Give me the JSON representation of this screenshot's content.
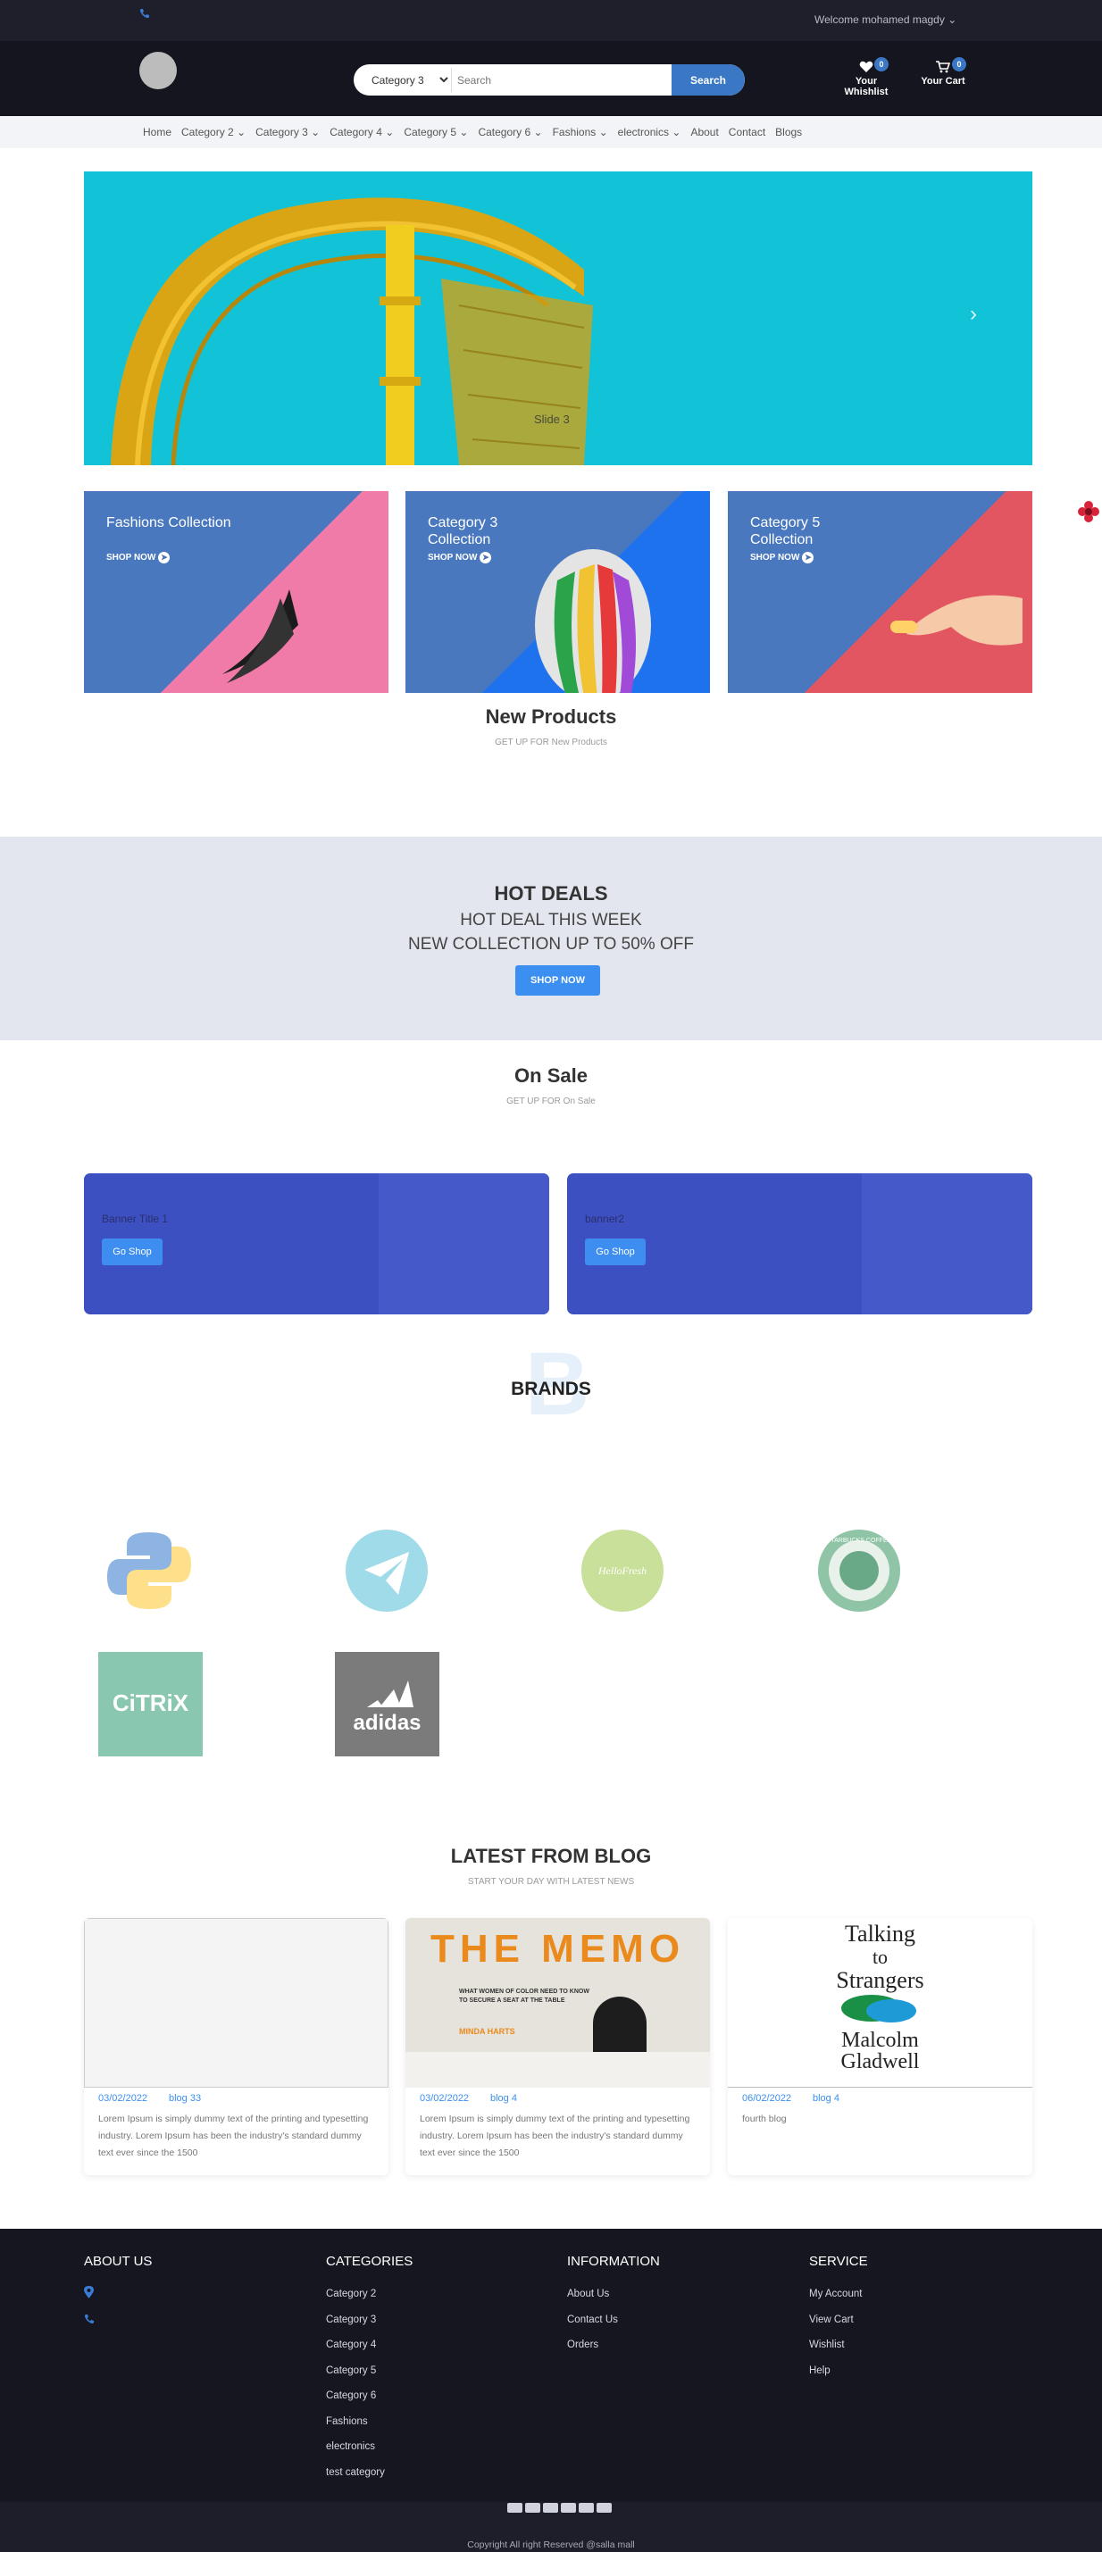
{
  "topbar": {
    "welcome": "Welcome mohamed magdy"
  },
  "header": {
    "search": {
      "category": "Category 3",
      "categories": [
        "Category 3"
      ],
      "placeholder": "Search",
      "button": "Search"
    },
    "wishlist": {
      "label": "Your Whishlist",
      "count": "0"
    },
    "cart": {
      "label": "Your Cart",
      "count": "0"
    }
  },
  "nav": {
    "items": [
      "Home",
      "Category 2",
      "Category 3",
      "Category 4",
      "Category 5",
      "Category 6",
      "Fashions",
      "electronics",
      "About",
      "Contact",
      "Blogs"
    ]
  },
  "slider": {
    "caption": "Slide 3"
  },
  "categories": [
    {
      "title": "Fashions Collection",
      "shop": "SHOP NOW"
    },
    {
      "title": "Category 3 Collection",
      "shop": "SHOP NOW"
    },
    {
      "title": "Category 5 Collection",
      "shop": "SHOP NOW"
    }
  ],
  "new_products": {
    "title": "New Products",
    "subtitle": "GET UP FOR New Products"
  },
  "hot_deals": {
    "title": "HOT DEALS",
    "line1": "HOT DEAL THIS WEEK",
    "line2": "NEW COLLECTION UP TO 50% OFF",
    "button": "SHOP NOW"
  },
  "on_sale": {
    "title": "On Sale",
    "subtitle": "GET UP FOR On Sale"
  },
  "banners": [
    {
      "title": "Banner Title 1",
      "button": "Go Shop"
    },
    {
      "title": "banner2",
      "button": "Go Shop"
    }
  ],
  "brands": {
    "title": "BRANDS",
    "bg_letter": "B",
    "citrix": "CiTRiX",
    "adidas": "adidas",
    "hellofresh": "HelloFresh",
    "starbucks": "STARBUCKS COFFEE"
  },
  "blog": {
    "title": "LATEST FROM BLOG",
    "subtitle": "START YOUR DAY WITH LATEST NEWS",
    "posts": [
      {
        "date": "03/02/2022",
        "name": "blog 33",
        "text": "Lorem Ipsum is simply dummy text of the printing and typesetting industry. Lorem Ipsum has been the industry's standard dummy text ever since the 1500"
      },
      {
        "date": "03/02/2022",
        "name": "blog 4",
        "text": "Lorem Ipsum is simply dummy text of the printing and typesetting industry. Lorem Ipsum has been the industry's standard dummy text ever since the 1500",
        "img_title": "THE MEMO",
        "img_sub": "WHAT WOMEN OF COLOR NEED TO KNOW TO SECURE A SEAT AT THE TABLE",
        "img_author": "MINDA HARTS"
      },
      {
        "date": "06/02/2022",
        "name": "blog 4",
        "text": "fourth blog",
        "img_title1": "Talking",
        "img_title2": "to",
        "img_title3": "Strangers",
        "img_author1": "Malcolm",
        "img_author2": "Gladwell"
      }
    ]
  },
  "footer": {
    "about": {
      "title": "ABOUT US"
    },
    "categories": {
      "title": "CATEGORIES",
      "items": [
        "Category 2",
        "Category 3",
        "Category 4",
        "Category 5",
        "Category 6",
        "Fashions",
        "electronics",
        "test category"
      ]
    },
    "information": {
      "title": "INFORMATION",
      "items": [
        "About Us",
        "Contact Us",
        "Orders"
      ]
    },
    "service": {
      "title": "SERVICE",
      "items": [
        "My Account",
        "View Cart",
        "Wishlist",
        "Help"
      ]
    },
    "copyright": "Copyright All right Reserved @salla mall"
  },
  "colors": {
    "accent": "#3a78c6",
    "dark": "#14151f",
    "hotdeals_bg": "#e3e6ee",
    "banner": "#3c50c2"
  }
}
